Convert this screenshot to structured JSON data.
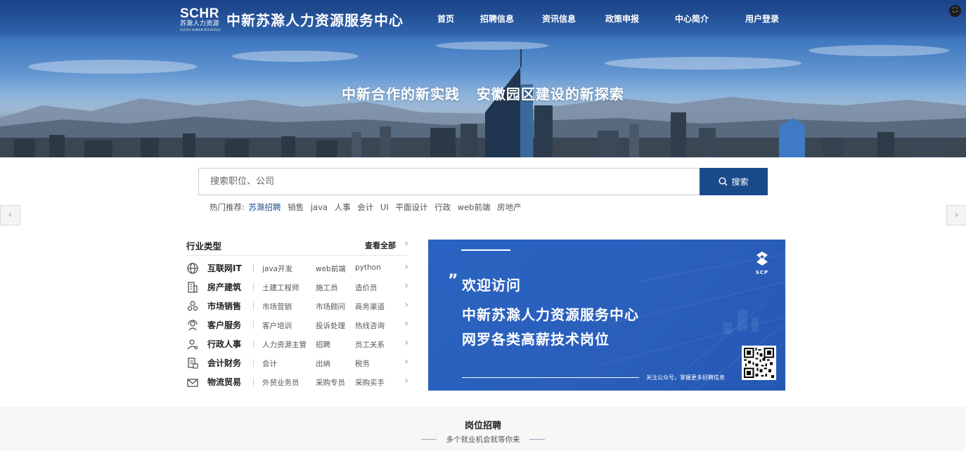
{
  "header": {
    "logo": {
      "mark": "SCHR",
      "sub": "苏滁人力资源",
      "tiny": "SUCHU HUMAN RESOURCE"
    },
    "site_title": "中新苏滁人力资源服务中心",
    "nav": [
      "首页",
      "招聘信息",
      "资讯信息",
      "政策申报",
      "中心简介",
      "用户登录"
    ],
    "tagline": "中新合作的新实践   安徽园区建设的新探索"
  },
  "search": {
    "placeholder": "搜索职位、公司",
    "button_label": "搜索",
    "hot_label": "热门推荐:",
    "hot_keywords": [
      "苏滁招聘",
      "销售",
      "java",
      "人事",
      "会计",
      "UI",
      "平面设计",
      "行政",
      "web前端",
      "房地产"
    ]
  },
  "industry": {
    "title": "行业类型",
    "view_all": "查看全部",
    "items": [
      {
        "icon": "globe-icon",
        "name": "互联网IT",
        "tags": [
          "java开发",
          "web前端",
          "python"
        ]
      },
      {
        "icon": "building-icon",
        "name": "房产建筑",
        "tags": [
          "土建工程师",
          "施工员",
          "造价员"
        ]
      },
      {
        "icon": "people-icon",
        "name": "市场销售",
        "tags": [
          "市场营销",
          "市场顾问",
          "商务渠道"
        ]
      },
      {
        "icon": "headset-icon",
        "name": "客户服务",
        "tags": [
          "客户培训",
          "投诉处理",
          "热线咨询"
        ]
      },
      {
        "icon": "person-gear-icon",
        "name": "行政人事",
        "tags": [
          "人力资源主管",
          "招聘",
          "员工关系"
        ]
      },
      {
        "icon": "ledger-icon",
        "name": "会计财务",
        "tags": [
          "会计",
          "出纳",
          "税务"
        ]
      },
      {
        "icon": "envelope-icon",
        "name": "物流贸易",
        "tags": [
          "外贸业务员",
          "采购专员",
          "采购买手"
        ]
      }
    ]
  },
  "banner": {
    "quote": "”",
    "welcome": "欢迎访问",
    "line1": "中新苏滁人力资源服务中心",
    "line2": "网罗各类高薪技术岗位",
    "follow": "关注公众号，掌握更多招聘信息",
    "logo_text": "SCP",
    "accent": "#2a5fbb"
  },
  "section": {
    "title": "岗位招聘",
    "subtitle": "多个就业机会就等你来"
  },
  "colors": {
    "primary": "#1a4a8a",
    "link": "#1a4a8a"
  }
}
